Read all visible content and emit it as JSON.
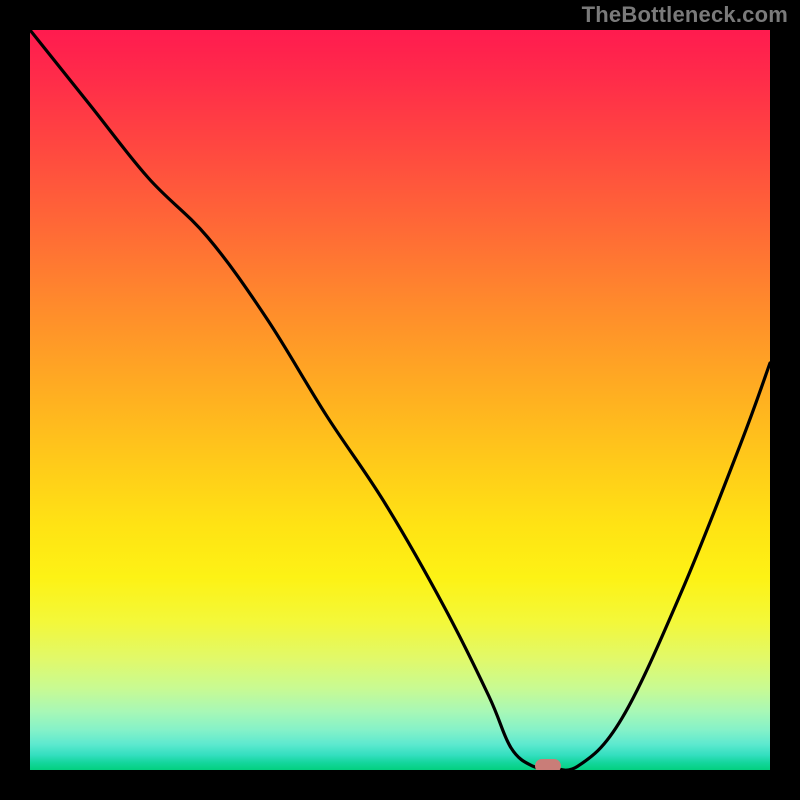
{
  "watermark": "TheBottleneck.com",
  "chart_data": {
    "type": "line",
    "title": "",
    "xlabel": "",
    "ylabel": "",
    "xlim": [
      0,
      100
    ],
    "ylim": [
      0,
      100
    ],
    "series": [
      {
        "name": "curve",
        "x": [
          0,
          8,
          16,
          24,
          32,
          40,
          48,
          56,
          62,
          65,
          68,
          70,
          74,
          80,
          88,
          96,
          100
        ],
        "y": [
          100,
          90,
          80,
          72,
          61,
          48,
          36,
          22,
          10,
          3,
          0.5,
          0.5,
          0.5,
          7,
          24,
          44,
          55
        ]
      }
    ],
    "marker": {
      "x": 70,
      "y": 0.5
    },
    "colors": {
      "curve": "#000000",
      "marker": "#c97d78",
      "gradient_top": "#ff1b4f",
      "gradient_bottom": "#03d07f"
    }
  }
}
